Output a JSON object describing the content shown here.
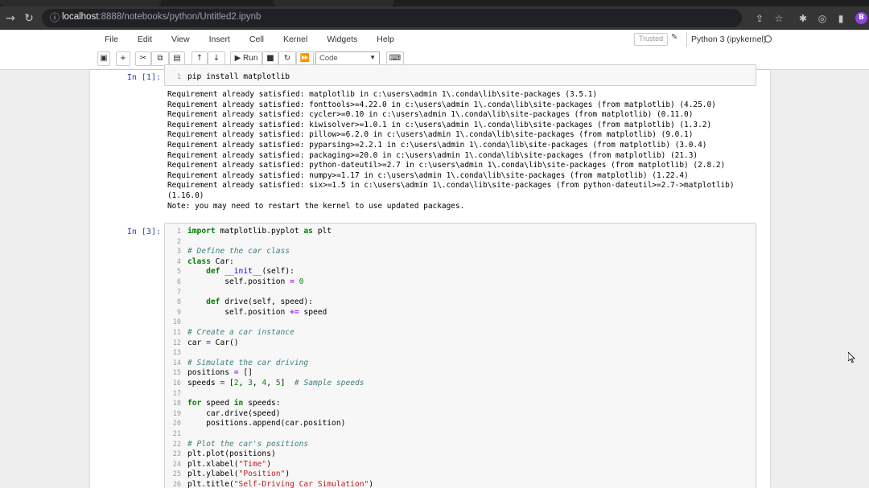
{
  "browser": {
    "url_host": "localhost",
    "url_rest": ":8888/notebooks/python/Untitled2.ipynb",
    "profile_initial": "B",
    "accent": "#8e44e0"
  },
  "menu": [
    "File",
    "Edit",
    "View",
    "Insert",
    "Cell",
    "Kernel",
    "Widgets",
    "Help"
  ],
  "header": {
    "trusted": "Trusted",
    "kernel": "Python 3 (ipykernel)"
  },
  "toolbar": {
    "run_label": "Run",
    "cell_type": "Code"
  },
  "cells": [
    {
      "prompt": "In [1]:",
      "code": [
        "pip install matplotlib"
      ],
      "output": [
        "Requirement already satisfied: matplotlib in c:\\users\\admin 1\\.conda\\lib\\site-packages (3.5.1)",
        "Requirement already satisfied: fonttools>=4.22.0 in c:\\users\\admin 1\\.conda\\lib\\site-packages (from matplotlib) (4.25.0)",
        "Requirement already satisfied: cycler>=0.10 in c:\\users\\admin 1\\.conda\\lib\\site-packages (from matplotlib) (0.11.0)",
        "Requirement already satisfied: kiwisolver>=1.0.1 in c:\\users\\admin 1\\.conda\\lib\\site-packages (from matplotlib) (1.3.2)",
        "Requirement already satisfied: pillow>=6.2.0 in c:\\users\\admin 1\\.conda\\lib\\site-packages (from matplotlib) (9.0.1)",
        "Requirement already satisfied: pyparsing>=2.2.1 in c:\\users\\admin 1\\.conda\\lib\\site-packages (from matplotlib) (3.0.4)",
        "Requirement already satisfied: packaging>=20.0 in c:\\users\\admin 1\\.conda\\lib\\site-packages (from matplotlib) (21.3)",
        "Requirement already satisfied: python-dateutil>=2.7 in c:\\users\\admin 1\\.conda\\lib\\site-packages (from matplotlib) (2.8.2)",
        "Requirement already satisfied: numpy>=1.17 in c:\\users\\admin 1\\.conda\\lib\\site-packages (from matplotlib) (1.22.4)",
        "Requirement already satisfied: six>=1.5 in c:\\users\\admin 1\\.conda\\lib\\site-packages (from python-dateutil>=2.7->matplotlib)",
        "(1.16.0)",
        "Note: you may need to restart the kernel to use updated packages."
      ]
    },
    {
      "prompt": "In [3]:",
      "code": [
        "import matplotlib.pyplot as plt",
        "",
        "# Define the car class",
        "class Car:",
        "    def __init__(self):",
        "        self.position = 0",
        "",
        "    def drive(self, speed):",
        "        self.position += speed",
        "",
        "# Create a car instance",
        "car = Car()",
        "",
        "# Simulate the car driving",
        "positions = []",
        "speeds = [2, 3, 4, 5]  # Sample speeds",
        "",
        "for speed in speeds:",
        "    car.drive(speed)",
        "    positions.append(car.position)",
        "",
        "# Plot the car's positions",
        "plt.plot(positions)",
        "plt.xlabel(\"Time\")",
        "plt.ylabel(\"Position\")",
        "plt.title(\"Self-Driving Car Simulation\")"
      ]
    }
  ]
}
